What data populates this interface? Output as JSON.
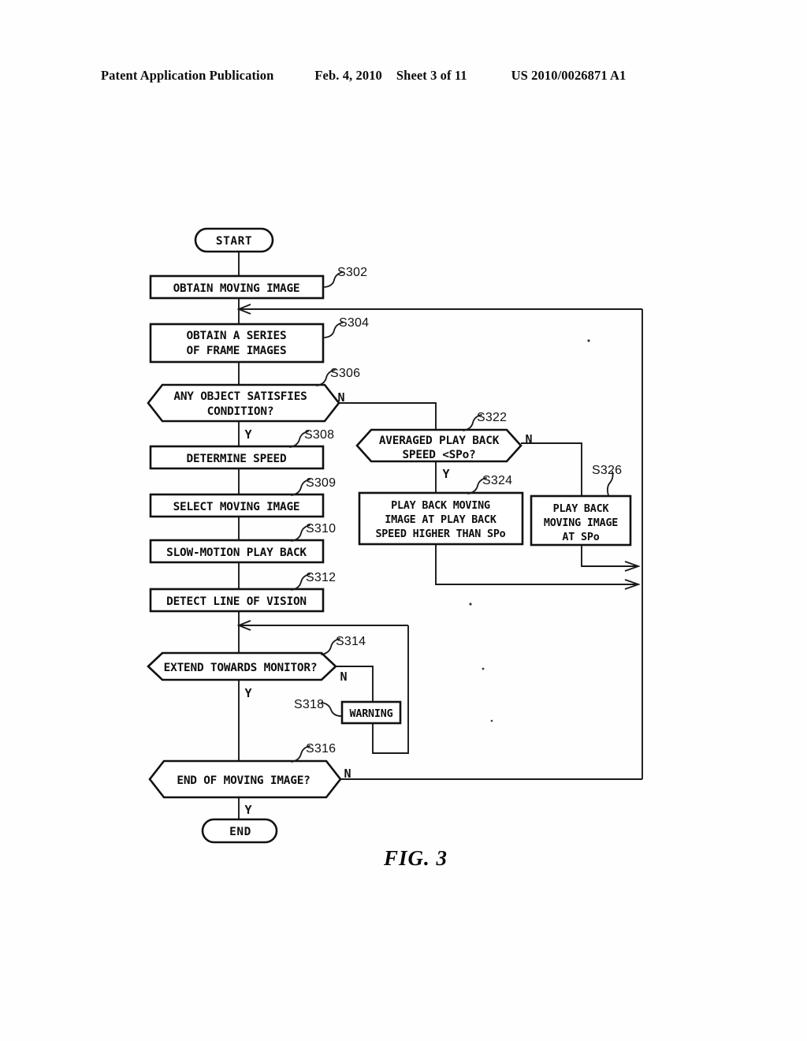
{
  "header": {
    "publication": "Patent Application Publication",
    "date": "Feb. 4, 2010",
    "sheet": "Sheet 3 of 11",
    "patent_number": "US 2010/0026871 A1"
  },
  "figure": {
    "caption": "FIG. 3"
  },
  "flowchart": {
    "start_label": "START",
    "end_label": "END",
    "nodes": [
      {
        "id": "start",
        "type": "terminator",
        "text": "START"
      },
      {
        "id": "s302",
        "type": "process",
        "step": "S302",
        "text": "OBTAIN MOVING IMAGE"
      },
      {
        "id": "s304",
        "type": "process",
        "step": "S304",
        "line1": "OBTAIN A SERIES",
        "line2": "OF FRAME IMAGES"
      },
      {
        "id": "s306",
        "type": "decision",
        "step": "S306",
        "line1": "ANY OBJECT SATISFIES",
        "line2": "CONDITION?",
        "yes": "Y",
        "no": "N"
      },
      {
        "id": "s308",
        "type": "process",
        "step": "S308",
        "text": "DETERMINE SPEED"
      },
      {
        "id": "s309",
        "type": "process",
        "step": "S309",
        "text": "SELECT MOVING IMAGE"
      },
      {
        "id": "s310",
        "type": "process",
        "step": "S310",
        "text": "SLOW-MOTION PLAY BACK"
      },
      {
        "id": "s312",
        "type": "process",
        "step": "S312",
        "text": "DETECT LINE OF VISION"
      },
      {
        "id": "s314",
        "type": "decision",
        "step": "S314",
        "text": "EXTEND TOWARDS MONITOR?",
        "yes": "Y",
        "no": "N"
      },
      {
        "id": "s318",
        "type": "process",
        "step": "S318",
        "text": "WARNING"
      },
      {
        "id": "s316",
        "type": "decision",
        "step": "S316",
        "text": "END OF MOVING IMAGE?",
        "yes": "Y",
        "no": "N"
      },
      {
        "id": "s322",
        "type": "decision",
        "step": "S322",
        "line1": "AVERAGED PLAY BACK",
        "line2": "SPEED <SPo?",
        "yes": "Y",
        "no": "N"
      },
      {
        "id": "s324",
        "type": "process",
        "step": "S324",
        "line1": "PLAY BACK MOVING",
        "line2": "IMAGE AT PLAY BACK",
        "line3": "SPEED HIGHER THAN SPo"
      },
      {
        "id": "s326",
        "type": "process",
        "step": "S326",
        "line1": "PLAY BACK",
        "line2": "MOVING IMAGE",
        "line3": "AT SPo"
      },
      {
        "id": "end",
        "type": "terminator",
        "text": "END"
      }
    ]
  },
  "colors": {
    "ink": "#111111",
    "paper": "#ffffff"
  }
}
